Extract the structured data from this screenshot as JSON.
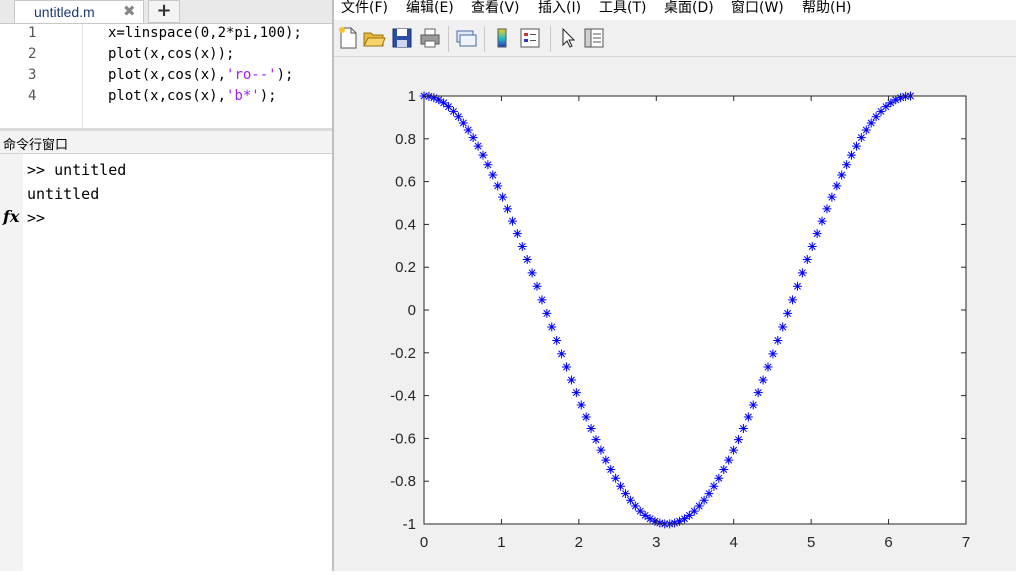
{
  "editor": {
    "tab_label": "untitled.m",
    "close_glyph": "✖",
    "add_glyph": "+",
    "line_numbers": [
      "1",
      "2",
      "3",
      "4"
    ],
    "lines": [
      {
        "before": "x=linspace(0,2*pi,100);",
        "str": "",
        "after": ""
      },
      {
        "before": "plot(x,cos(x));",
        "str": "",
        "after": ""
      },
      {
        "before": "plot(x,cos(x),",
        "str": "'ro--'",
        "after": ");"
      },
      {
        "before": "plot(x,cos(x),",
        "str": "'b*'",
        "after": ");"
      }
    ]
  },
  "command_window": {
    "title": "命令行窗口",
    "lines": [
      ">> untitled",
      "untitled",
      ">>"
    ],
    "fx_label": "fx"
  },
  "figure": {
    "menu": [
      "文件(F)",
      "编辑(E)",
      "查看(V)",
      "插入(I)",
      "工具(T)",
      "桌面(D)",
      "窗口(W)",
      "帮助(H)"
    ],
    "toolbar_icons": [
      "new-figure-icon",
      "open-file-icon",
      "save-icon",
      "print-icon",
      "link-plot-icon",
      "insert-colorbar-icon",
      "insert-legend-icon",
      "edit-plot-arrow-icon",
      "property-inspector-icon"
    ]
  },
  "chart_data": {
    "type": "scatter",
    "marker": "*",
    "color": "#0000ff",
    "function": "y = cos(x), x = linspace(0, 2*pi, 100)",
    "n_points": 100,
    "x_range": [
      0,
      6.2832
    ],
    "xlim": [
      0,
      7
    ],
    "ylim": [
      -1,
      1
    ],
    "xticks": [
      "0",
      "1",
      "2",
      "3",
      "4",
      "5",
      "6",
      "7"
    ],
    "yticks": [
      "1",
      "0.8",
      "0.6",
      "0.4",
      "0.2",
      "0",
      "-0.2",
      "-0.4",
      "-0.6",
      "-0.8",
      "-1"
    ],
    "grid": false
  }
}
